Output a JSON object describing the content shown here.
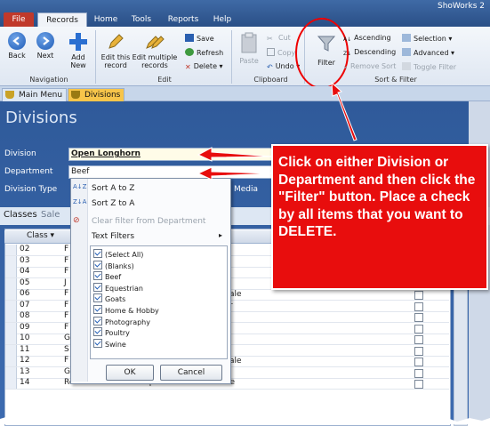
{
  "app": {
    "title": "ShoWorks 2"
  },
  "menu_tabs": [
    "File",
    "Records",
    "Home",
    "Tools",
    "Reports",
    "Help"
  ],
  "ribbon": {
    "navigation": {
      "label": "Navigation",
      "back": "Back",
      "next": "Next"
    },
    "add": {
      "label": "Add New",
      "line1": "Add",
      "line2": "New"
    },
    "edit": {
      "label": "Edit",
      "edit_record_l1": "Edit this",
      "edit_record_l2": "record",
      "edit_multi_l1": "Edit multiple",
      "edit_multi_l2": "records"
    },
    "records": {
      "save": "Save",
      "refresh": "Refresh",
      "delete": "Delete"
    },
    "clipboard": {
      "label": "Clipboard",
      "paste": "Paste",
      "cut": "Cut",
      "copy": "Copy",
      "undo": "Undo"
    },
    "sortfilter": {
      "label": "Sort & Filter",
      "filter": "Filter",
      "ascending": "Ascending",
      "descending": "Descending",
      "remove_sort": "Remove Sort",
      "selection": "Selection",
      "advanced": "Advanced",
      "toggle_filter": "Toggle Filter"
    }
  },
  "doc_tabs": [
    "Main Menu",
    "Divisions"
  ],
  "page": {
    "title": "Divisions",
    "division_label": "Division",
    "division_value": "Open Longhorn",
    "department_label": "Department",
    "department_value": "Beef",
    "division_type_label": "Division Type",
    "media_label": "Media"
  },
  "subtabs": [
    "Classes",
    "Sale"
  ],
  "grid": {
    "header": "Class",
    "rows": [
      {
        "num": "02",
        "name": "F"
      },
      {
        "num": "03",
        "name": "F"
      },
      {
        "num": "04",
        "name": "F"
      },
      {
        "num": "05",
        "name": "J"
      },
      {
        "num": "06",
        "name": "F",
        "extra": "ale"
      },
      {
        "num": "07",
        "name": "F",
        "extra": "r"
      },
      {
        "num": "08",
        "name": "F"
      },
      {
        "num": "09",
        "name": "F"
      },
      {
        "num": "10",
        "name": "G"
      },
      {
        "num": "11",
        "name": "S"
      },
      {
        "num": "12",
        "name": "F",
        "extra": "ale"
      },
      {
        "num": "13",
        "name": "Grand Champion Haltered Female"
      },
      {
        "num": "14",
        "name": "Reserve Grand Champion Haltered Female"
      }
    ]
  },
  "filter_popup": {
    "sort_asc": "Sort A to Z",
    "sort_desc": "Sort Z to A",
    "clear_filter": "Clear filter from Department",
    "text_filters": "Text Filters",
    "items": [
      "(Select All)",
      "(Blanks)",
      "Beef",
      "Equestrian",
      "Goats",
      "Home & Hobby",
      "Photography",
      "Poultry",
      "Swine"
    ],
    "ok": "OK",
    "cancel": "Cancel"
  },
  "callout": {
    "text": "Click on either Division or Department and then click the \"Filter\" button. Place a check by all items that you want to DELETE.",
    "color": "#e80d0d"
  }
}
